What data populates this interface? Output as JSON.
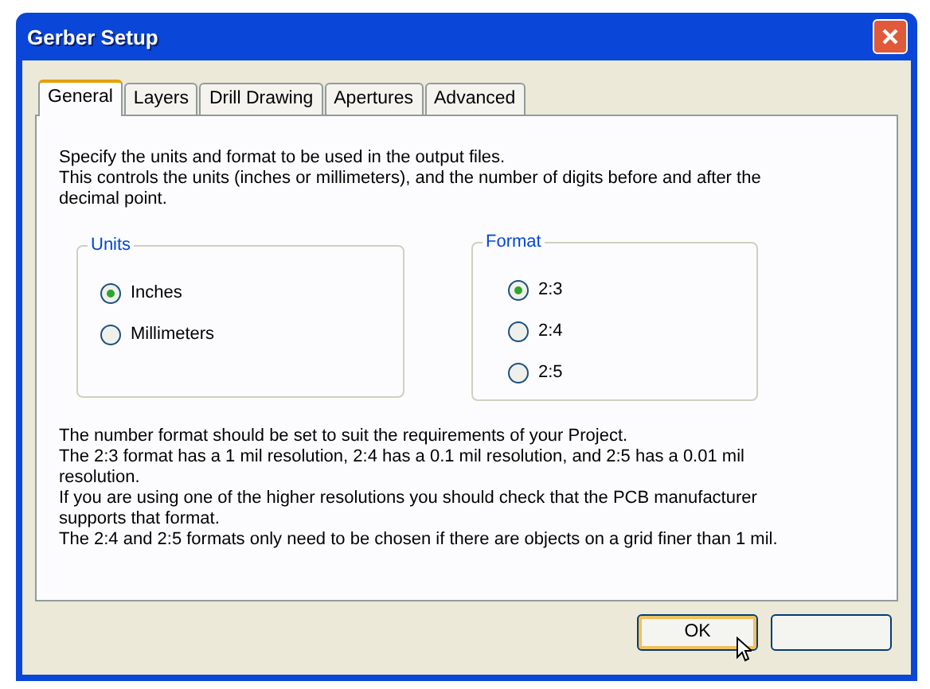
{
  "window": {
    "title": "Gerber Setup"
  },
  "tabs": [
    {
      "label": "General",
      "selected": true
    },
    {
      "label": "Layers",
      "selected": false
    },
    {
      "label": "Drill Drawing",
      "selected": false
    },
    {
      "label": "Apertures",
      "selected": false
    },
    {
      "label": "Advanced",
      "selected": false
    }
  ],
  "intro": [
    "Specify the units and format to be used in the output files.",
    "This controls the units (inches or millimeters), and the number of digits before and after the decimal point."
  ],
  "groups": [
    {
      "title": "Units",
      "options": [
        {
          "label": "Inches",
          "selected": true
        },
        {
          "label": "Millimeters",
          "selected": false
        }
      ]
    },
    {
      "title": "Format",
      "options": [
        {
          "label": "2:3",
          "selected": true
        },
        {
          "label": "2:4",
          "selected": false
        },
        {
          "label": "2:5",
          "selected": false
        }
      ]
    }
  ],
  "notes": [
    "The number format should be set to suit the requirements of your Project.",
    "The 2:3 format has a 1 mil resolution, 2:4 has a 0.1 mil resolution, and 2:5 has a 0.01 mil resolution.",
    "If you are using one of the higher resolutions you should check that the PCB manufacturer supports that format.",
    "The 2:4 and 2:5 formats only need to be chosen if there are objects on a grid finer than 1 mil."
  ],
  "buttons": [
    {
      "label": "OK",
      "kind": "default"
    },
    {
      "kind": "plain"
    }
  ]
}
